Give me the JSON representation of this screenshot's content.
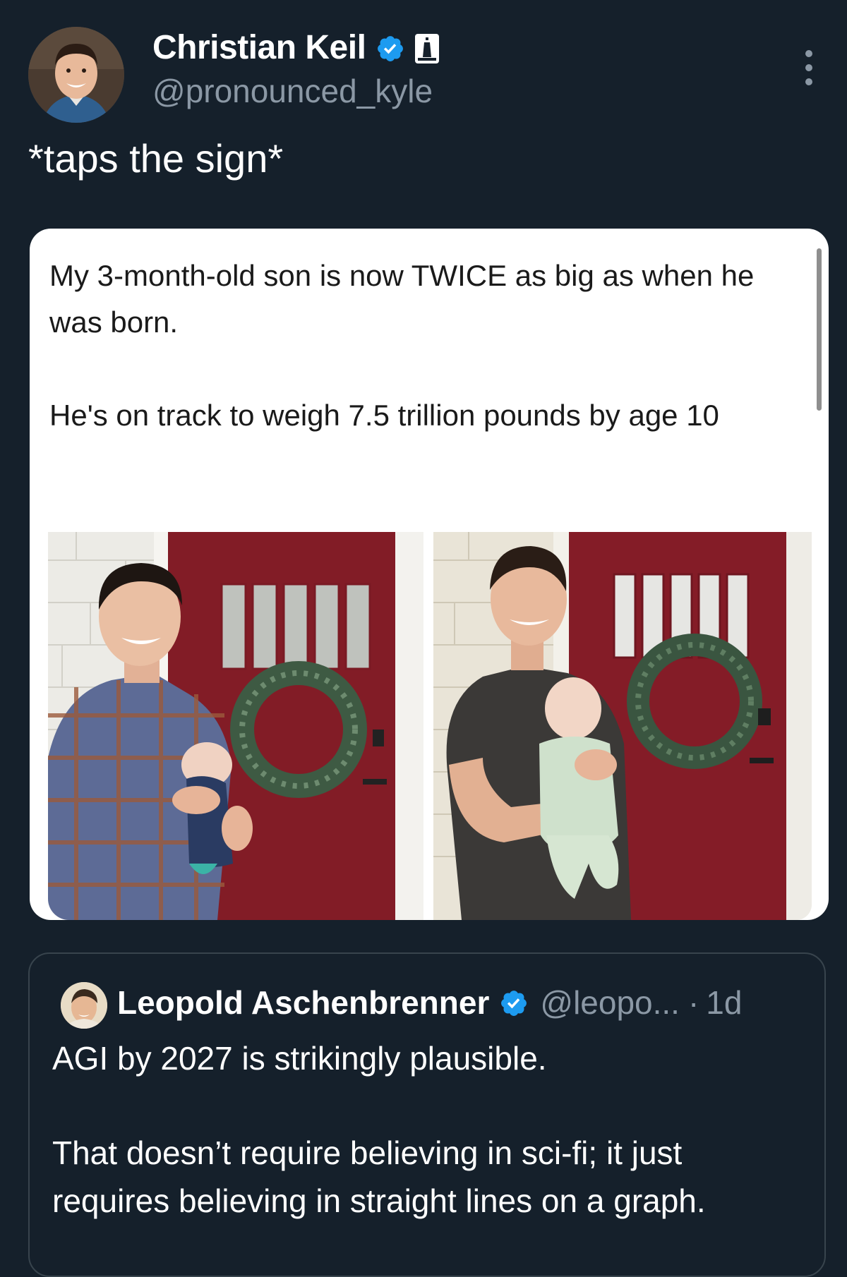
{
  "author": {
    "display_name": "Christian Keil",
    "handle": "@pronounced_kyle",
    "verified": true,
    "affiliate_badge": "lighthouse-icon"
  },
  "tweet": {
    "text": "*taps the sign*"
  },
  "embedded_screenshot": {
    "paragraph_1": "My 3-month-old son is now TWICE as big as when he was born.",
    "paragraph_2": "He's on track to weigh 7.5 trillion pounds by age 10",
    "photos": [
      "father-holding-newborn-photo",
      "father-holding-3-month-old-photo"
    ]
  },
  "quoted_tweet": {
    "display_name": "Leopold Aschenbrenner",
    "verified": true,
    "handle": "@leopo...",
    "separator": "·",
    "time": "1d",
    "paragraph_1": "AGI by 2027 is strikingly plausible.",
    "paragraph_2": "That doesn’t require believing in sci-fi; it just requires believing in straight lines on a graph."
  },
  "colors": {
    "background": "#15202b",
    "verified_blue": "#1d9bf0",
    "secondary_text": "#8b98a5",
    "border": "#38444d",
    "door_red": "#8e1f2a"
  }
}
